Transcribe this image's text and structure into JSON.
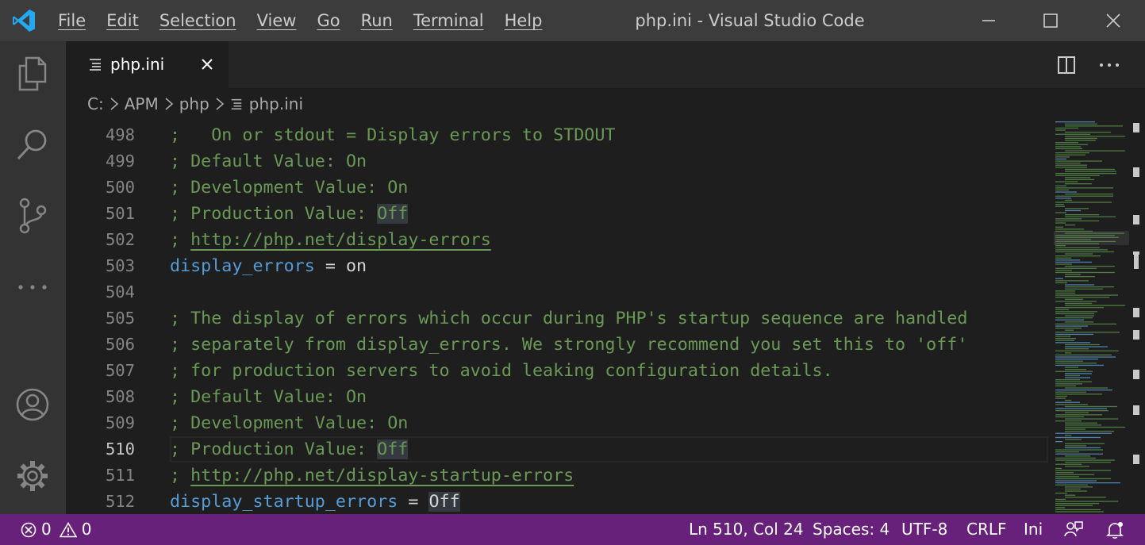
{
  "titlebar": {
    "menu": [
      "File",
      "Edit",
      "Selection",
      "View",
      "Go",
      "Run",
      "Terminal",
      "Help"
    ],
    "window_title": "php.ini - Visual Studio Code"
  },
  "activitybar": {
    "icons": [
      "explorer-icon",
      "search-icon",
      "source-control-icon",
      "more-icon",
      "account-icon",
      "settings-gear-icon"
    ]
  },
  "tab": {
    "label": "php.ini"
  },
  "breadcrumb": {
    "drive": "C:",
    "folder1": "APM",
    "folder2": "php",
    "file": "php.ini"
  },
  "editor": {
    "current_line": 510,
    "lines": [
      {
        "num": "498",
        "text": ";   On or stdout = Display errors to STDOUT"
      },
      {
        "num": "499",
        "text": "; Default Value: On"
      },
      {
        "num": "500",
        "text": "; Development Value: On"
      },
      {
        "num": "501",
        "prefix": "; Production Value: ",
        "value": "Off"
      },
      {
        "num": "502",
        "prefix": "; ",
        "link": "http://php.net/display-errors"
      },
      {
        "num": "503",
        "key": "display_errors",
        "op": " = ",
        "val": "on"
      },
      {
        "num": "504",
        "text": ""
      },
      {
        "num": "505",
        "text": "; The display of errors which occur during PHP's startup sequence are handled"
      },
      {
        "num": "506",
        "text": "; separately from display_errors. We strongly recommend you set this to 'off'"
      },
      {
        "num": "507",
        "text": "; for production servers to avoid leaking configuration details."
      },
      {
        "num": "508",
        "text": "; Default Value: On"
      },
      {
        "num": "509",
        "text": "; Development Value: On"
      },
      {
        "num": "510",
        "prefix": "; Production Value: ",
        "value": "Off"
      },
      {
        "num": "511",
        "prefix": "; ",
        "link": "http://php.net/display-startup-errors"
      },
      {
        "num": "512",
        "key": "display_startup_errors",
        "op": " = ",
        "val": "Off"
      }
    ]
  },
  "statusbar": {
    "errors": "0",
    "warnings": "0",
    "position": "Ln 510, Col 24",
    "spaces": "Spaces: 4",
    "encoding": "UTF-8",
    "eol": "CRLF",
    "language": "Ini"
  },
  "colors": {
    "statusbar": "#68217a",
    "comment": "#6a9955",
    "keyword": "#569cd6",
    "logo": "#23a9f2"
  }
}
